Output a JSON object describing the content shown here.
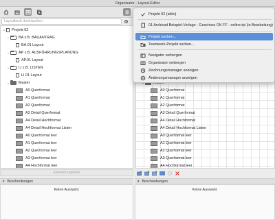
{
  "window": {
    "title": "Organisator - Layout-Editor"
  },
  "left": {
    "search_placeholder": "Layoutbuch durchsuchen",
    "tree": [
      {
        "label": "Projekt 02"
      },
      {
        "label": "BA z.B. BAUANTRAG"
      },
      {
        "label": "BA.01 Layout"
      },
      {
        "label": "AP z.B. AUSFÜHRUNGSPLANUNG"
      },
      {
        "label": "AP.01 Layout"
      },
      {
        "label": "LI z.B. LISTEN"
      },
      {
        "label": "LI.01 Layout"
      },
      {
        "label": "Master"
      },
      {
        "label": "A0 Querformat"
      },
      {
        "label": "A1 Querformat"
      },
      {
        "label": "A2 Querformat"
      },
      {
        "label": "A3 Detail Querformat"
      },
      {
        "label": "A4 Detail Hochformat"
      },
      {
        "label": "A4 Detail Hochformat Listen"
      },
      {
        "label": "A0 Querformat leer"
      },
      {
        "label": "A1 Querformat leer"
      },
      {
        "label": "A2 Querformat leer"
      },
      {
        "label": "A3 Querformat leer"
      },
      {
        "label": "A4 Hochformat leer"
      }
    ],
    "footer_button": "Element kopieren",
    "descriptions_title": "Beschreibungen",
    "descriptions_text": "Keine Auswahl."
  },
  "right": {
    "items": [
      {
        "label": "Master"
      },
      {
        "label": "A0 Querformat"
      },
      {
        "label": "A1 Querformat"
      },
      {
        "label": "A2 Querformat"
      },
      {
        "label": "A3 Detail Querformat"
      },
      {
        "label": "A4 Detail Hochformat"
      },
      {
        "label": "A4 Detail Hochformat Listen"
      },
      {
        "label": "A0 Querformat leer"
      },
      {
        "label": "A1 Querformat leer"
      },
      {
        "label": "A2 Querformat leer"
      },
      {
        "label": "A3 Querformat leer"
      },
      {
        "label": "A4 Hochformat leer"
      }
    ],
    "descriptions_title": "Beschreibungen",
    "descriptions_text": "Keine Auswahl."
  },
  "menu": {
    "items": [
      {
        "label": "Projekt 02 (aktiv)",
        "icon": "checkmark-icon"
      },
      {
        "label": "01 Archicad Beispiel-Vorlage - Geschoss OK FF - online.tpl (in Bearbeitung)",
        "icon": "document-icon"
      },
      {
        "label": "Projekt suchen...",
        "icon": "folder-icon"
      },
      {
        "label": "Teamwork-Projekt suchen...",
        "icon": "teamwork-icon"
      },
      {
        "label": "Navigator verbergen",
        "icon": "navigator-icon"
      },
      {
        "label": "Organisator verbergen",
        "icon": "organizer-icon"
      },
      {
        "label": "Zeichnungsmanager anzeigen",
        "icon": "drawing-manager-icon"
      },
      {
        "label": "Änderungsmanager anzeigen",
        "icon": "change-manager-icon"
      }
    ]
  },
  "colors": {
    "highlight": "#5b8fd9",
    "active_button": "#8f8f8f"
  }
}
